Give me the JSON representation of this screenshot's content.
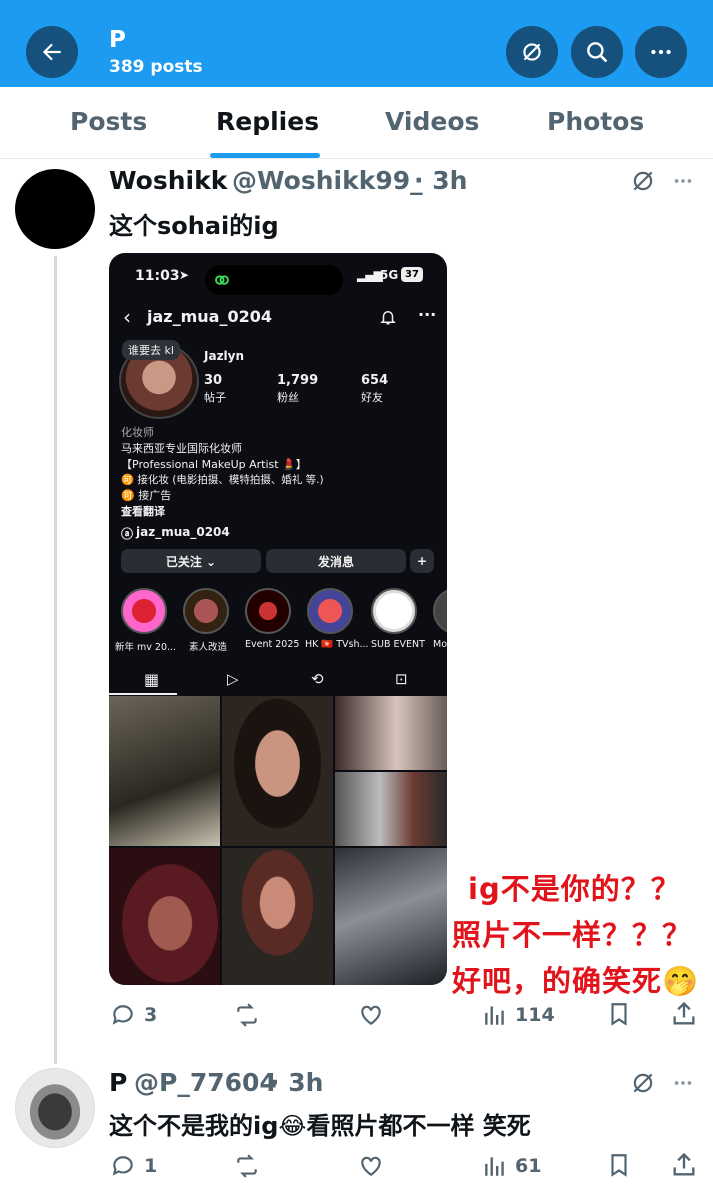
{
  "header": {
    "title": "P",
    "post_count": "389 posts"
  },
  "tabs": [
    {
      "label": "Posts"
    },
    {
      "label": "Replies"
    },
    {
      "label": "Videos"
    },
    {
      "label": "Photos"
    }
  ],
  "tweets": [
    {
      "name": "Woshikk",
      "handle": "@Woshikk99_",
      "time": "· 3h",
      "text": "这个sohai的ig",
      "replies": "3",
      "views": "114",
      "screenshot": {
        "time": "11:03",
        "signal": "5G",
        "battery": "37",
        "username": "jaz_mua_0204",
        "note": "谁要去 kl",
        "display_name": "Jazlyn",
        "stats": [
          {
            "value": "30",
            "label": "帖子"
          },
          {
            "value": "1,799",
            "label": "粉丝"
          },
          {
            "value": "654",
            "label": "好友"
          }
        ],
        "bio": [
          "化妆师",
          "马来西亚专业国际化妆师",
          "【Professional MakeUp Artist 💄】",
          "🉑 接化妆 (电影拍摄、模特拍摄、婚礼 等.)",
          "🉑 接广告",
          "查看翻译"
        ],
        "threads_handle": "jaz_mua_0204",
        "follow_btn": "已关注 ⌄",
        "message_btn": "发消息",
        "highlights": [
          "新年 mv 20...",
          "素人改造",
          "Event 2025",
          "HK 🇭🇰 TVsh...",
          "SUB EVENT",
          "Mo"
        ]
      }
    },
    {
      "name": "P",
      "handle": "@P_77604",
      "time": "· 3h",
      "text": "这个不是我的ig😂看照片都不一样 笑死",
      "replies": "1",
      "views": "61"
    }
  ],
  "annotation": {
    "line1": "ig不是你的？？",
    "line2": "照片不一样？？？",
    "line3": "好吧，的确笑死🤭"
  },
  "colors": {
    "header_bg": "#1d9bf0",
    "header_button_bg": "#15517c",
    "accent": "#1d9bf0",
    "annotation": "#e1141b"
  },
  "icons": {
    "back": "arrow-left-icon",
    "grok": "grok-slash-icon",
    "search": "search-icon",
    "more": "ellipsis-icon",
    "reply": "reply-bubble-icon",
    "retweet": "retweet-icon",
    "like": "heart-icon",
    "views": "bar-chart-icon",
    "bookmark": "bookmark-icon",
    "share": "share-icon"
  }
}
